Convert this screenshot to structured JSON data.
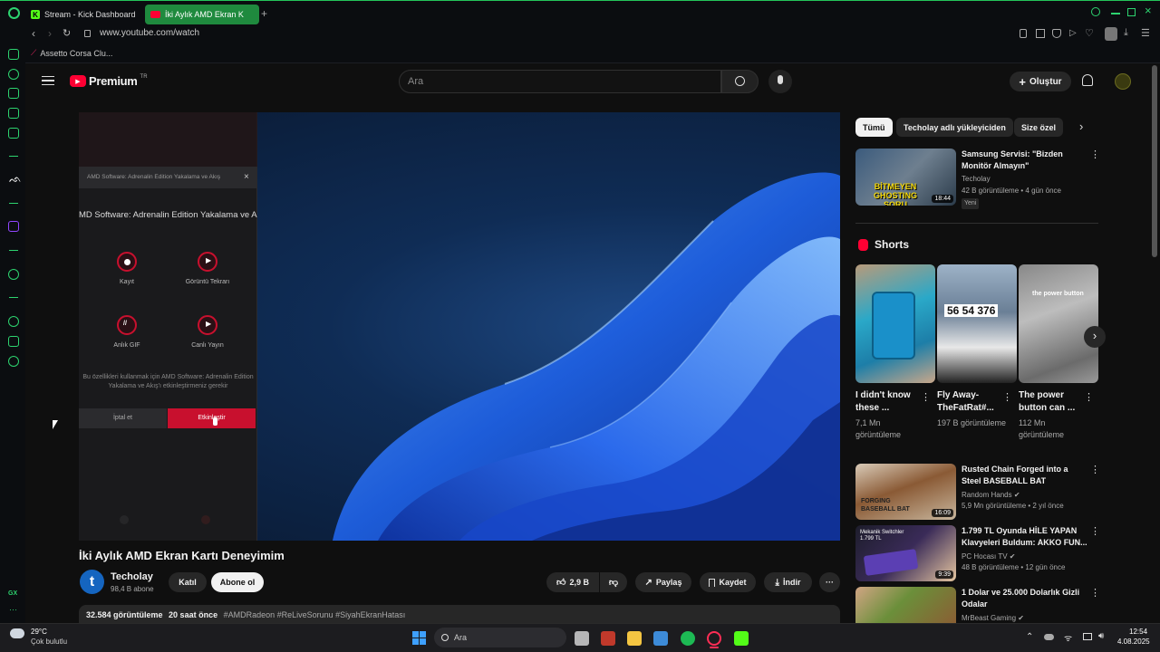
{
  "browser": {
    "tabs": [
      {
        "label": "Stream - Kick Dashboard"
      },
      {
        "label": "İki Aylık AMD Ekran K"
      }
    ],
    "url": "www.youtube.com/watch",
    "bookmark": "Assetto Corsa Clu..."
  },
  "masthead": {
    "logo": "Premium",
    "region": "TR",
    "search_placeholder": "Ara",
    "create_label": "Oluştur"
  },
  "amd_dialog": {
    "header": "AMD Software: Adrenalin Edition Yakalama ve Akış",
    "title": "MD Software: Adrenalin Edition Yakalama ve A",
    "features": [
      {
        "label": "Kayıt"
      },
      {
        "label": "Görüntü Tekrarı"
      },
      {
        "label": "Anlık GIF"
      },
      {
        "label": "Canlı Yayın"
      }
    ],
    "message": "Bu özellikleri kullanmak için AMD Software: Adrenalin Edition Yakalama ve Akış'ı etkinleştirmeniz gerekir",
    "cancel": "İptal et",
    "enable": "Etkinleştir"
  },
  "video": {
    "title": "İki Aylık AMD Ekran Kartı Deneyimim",
    "channel": "Techolay",
    "subscribers": "98,4 B abone",
    "join": "Katıl",
    "subscribe": "Abone ol",
    "likes": "2,9 B",
    "share": "Paylaş",
    "save": "Kaydet",
    "download": "İndir",
    "views": "32.584 görüntüleme",
    "age": "20 saat önce",
    "hashtags": "#AMDRadeon #ReLiveSorunu #SiyahEkranHatası"
  },
  "sidebar": {
    "chips": [
      {
        "label": "Tümü"
      },
      {
        "label": "Techolay adlı yükleyiciden"
      },
      {
        "label": "Size özel"
      }
    ],
    "first_video": {
      "title": "Samsung Servisi: \"Bizden Monitör Almayın\"",
      "channel": "Techolay",
      "meta": "42 B görüntüleme • 4 gün önce",
      "badge": "Yeni",
      "duration": "18:44",
      "thumb_text": "BİTMEYEN GHOSTING SORU"
    },
    "shorts_title": "Shorts",
    "shorts": [
      {
        "title": "I didn't know these ...",
        "views": "7,1 Mn görüntüleme"
      },
      {
        "title": "Fly Away-TheFatRat#...",
        "views": "197 B görüntüleme",
        "thumb_text": "56 54 376"
      },
      {
        "title": "The power button can ...",
        "views": "112 Mn görüntüleme",
        "thumb_text": "the power button"
      }
    ],
    "videos": [
      {
        "title": "Rusted Chain Forged into a Steel BASEBALL BAT",
        "channel": "Random Hands",
        "meta": "5,9 Mn görüntüleme • 2 yıl önce",
        "duration": "16:09",
        "thumb_text": "FORGING BASEBALL BAT"
      },
      {
        "title": "1.799 TL Oyunda HİLE YAPAN Klavyeleri Buldum: AKKO FUN...",
        "channel": "PC Hocası TV",
        "meta": "48 B görüntüleme • 12 gün önce",
        "duration": "9:39",
        "thumb_text": "Mekanik Switchler 1.799 TL"
      },
      {
        "title": "1 Dolar ve 25.000 Dolarlık Gizli Odalar",
        "channel": "MrBeast Gaming",
        "meta": ""
      }
    ]
  },
  "taskbar": {
    "weather_temp": "29°C",
    "weather_desc": "Çok bulutlu",
    "search": "Ara",
    "time": "12:54",
    "date": "4.08.2025"
  },
  "opera_sidebar": {
    "gx_label": "GX"
  },
  "colors": {
    "accent": "#ff0033",
    "amd_red": "#c8102e",
    "opera_green": "#2dd36f"
  }
}
